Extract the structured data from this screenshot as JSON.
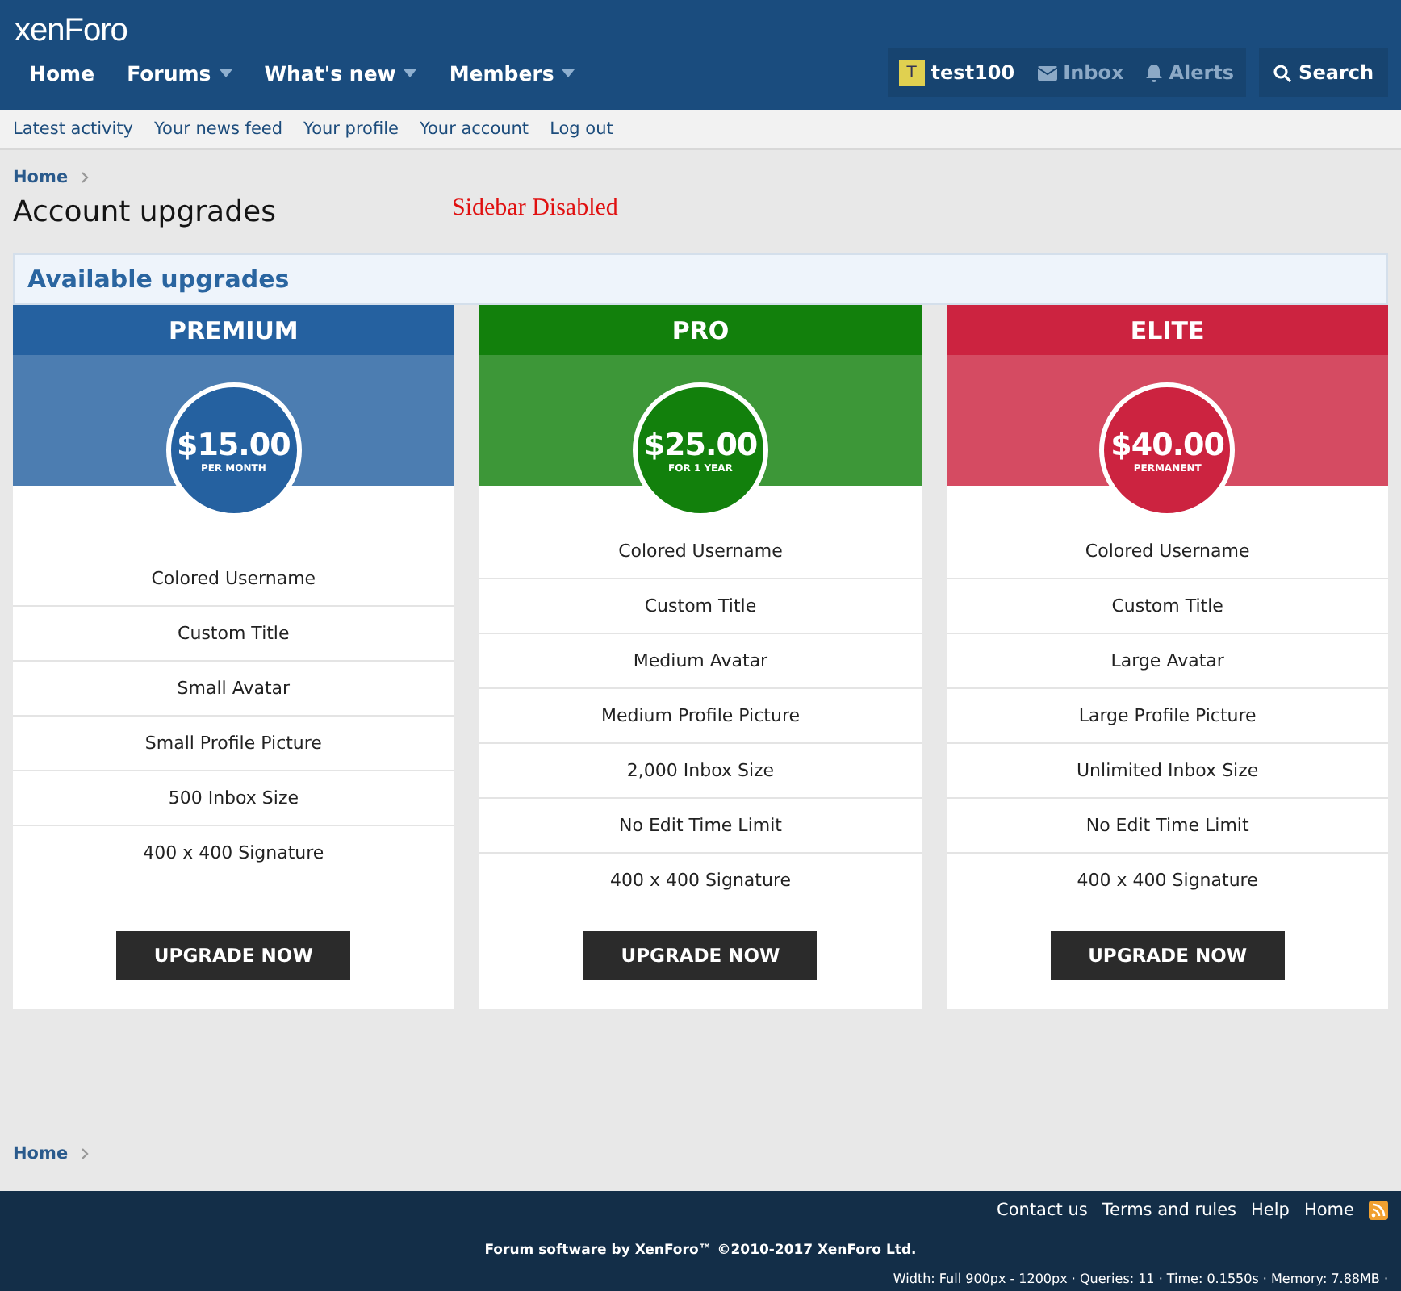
{
  "header": {
    "logo": "xenForo"
  },
  "nav": {
    "items": [
      {
        "label": "Home",
        "dropdown": false
      },
      {
        "label": "Forums",
        "dropdown": true
      },
      {
        "label": "What's new",
        "dropdown": true
      },
      {
        "label": "Members",
        "dropdown": true
      }
    ],
    "account": [
      {
        "kind": "user",
        "avatar_letter": "T",
        "label": "test100",
        "dimmed": false
      },
      {
        "kind": "inbox",
        "label": "Inbox",
        "dimmed": true
      },
      {
        "kind": "alerts",
        "label": "Alerts",
        "dimmed": true
      }
    ],
    "search": "Search"
  },
  "subnav": [
    "Latest activity",
    "Your news feed",
    "Your profile",
    "Your account",
    "Log out"
  ],
  "breadcrumb": [
    "Home"
  ],
  "page_title": "Account upgrades",
  "note": "Sidebar Disabled",
  "block_title": "Available upgrades",
  "plans": [
    {
      "title": "PREMIUM",
      "price": "$15.00",
      "term": "PER MONTH",
      "color": "#2561a0",
      "features": [
        "Colored Username",
        "Custom Title",
        "Small Avatar",
        "Small Profile Picture",
        "500 Inbox Size",
        "400 x 400 Signature"
      ],
      "button": "UPGRADE NOW"
    },
    {
      "title": "PRO",
      "price": "$25.00",
      "term": "FOR 1 YEAR",
      "color": "#12800c",
      "features": [
        "Colored Username",
        "Custom Title",
        "Medium Avatar",
        "Medium Profile Picture",
        "2,000 Inbox Size",
        "No Edit Time Limit",
        "400 x 400 Signature"
      ],
      "button": "UPGRADE NOW"
    },
    {
      "title": "ELITE",
      "price": "$40.00",
      "term": "PERMANENT",
      "color": "#cc2340",
      "features": [
        "Colored Username",
        "Custom Title",
        "Large Avatar",
        "Large Profile Picture",
        "Unlimited Inbox Size",
        "No Edit Time Limit",
        "400 x 400 Signature"
      ],
      "button": "UPGRADE NOW"
    }
  ],
  "footer_breadcrumb": [
    "Home"
  ],
  "footer": {
    "links": [
      "Contact us",
      "Terms and rules",
      "Help",
      "Home"
    ],
    "copyright": "Forum software by XenForo™ ©2010-2017 XenForo Ltd.",
    "stats": "Width: Full 900px - 1200px · Queries: 11 · Time: 0.1550s · Memory: 7.88MB ·"
  }
}
